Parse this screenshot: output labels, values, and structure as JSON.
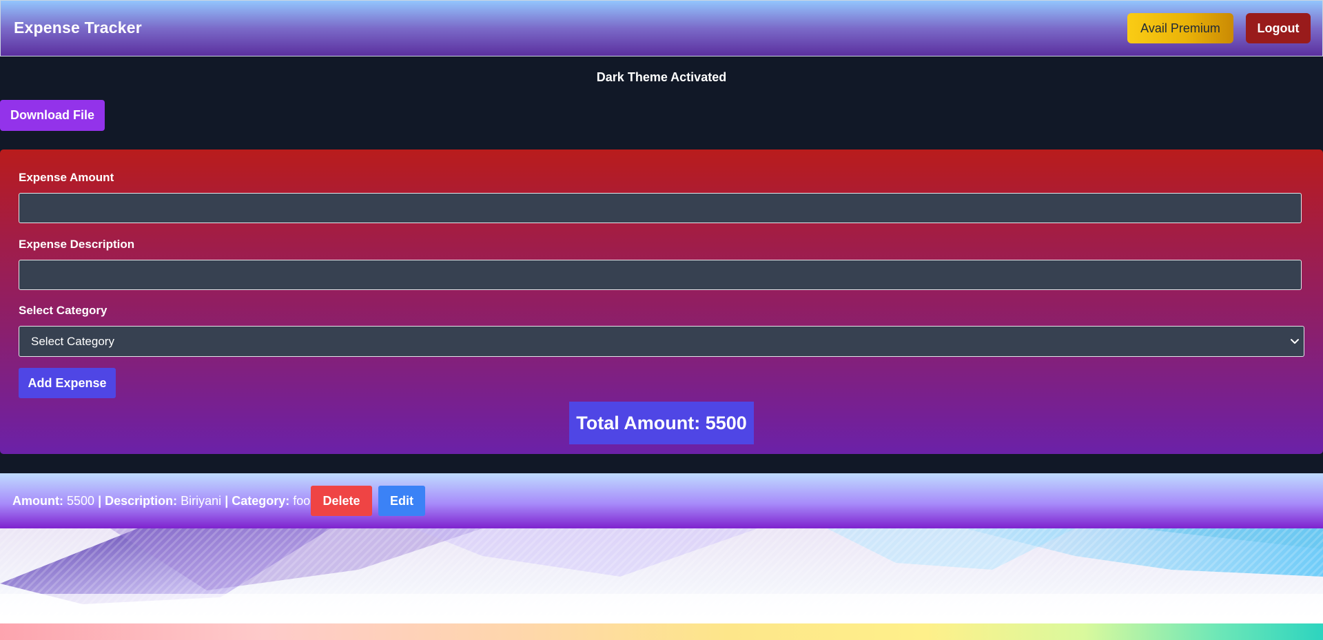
{
  "header": {
    "brand": "Expense Tracker",
    "premium_label": "Avail Premium",
    "logout_label": "Logout"
  },
  "theme_notice": "Dark Theme Activated",
  "download_label": "Download File",
  "form": {
    "amount_label": "Expense Amount",
    "amount_value": "",
    "description_label": "Expense Description",
    "description_value": "",
    "category_label": "Select Category",
    "category_selected": "Select Category",
    "add_label": "Add Expense"
  },
  "total": {
    "label": "Total Amount: 5500",
    "value": 5500
  },
  "expenses": [
    {
      "amount_key": "Amount:",
      "amount": "5500",
      "sep1": "|",
      "description_key": "Description:",
      "description": "Biriyani",
      "sep2": "|",
      "category_key": "Category:",
      "category": "food",
      "delete_label": "Delete",
      "edit_label": "Edit"
    }
  ],
  "colors": {
    "page_bg": "#111827",
    "premium": "#eab308",
    "logout": "#991b1b",
    "download": "#9333ea",
    "add": "#4f46e5",
    "delete": "#ef4444",
    "edit": "#3b82f6"
  }
}
